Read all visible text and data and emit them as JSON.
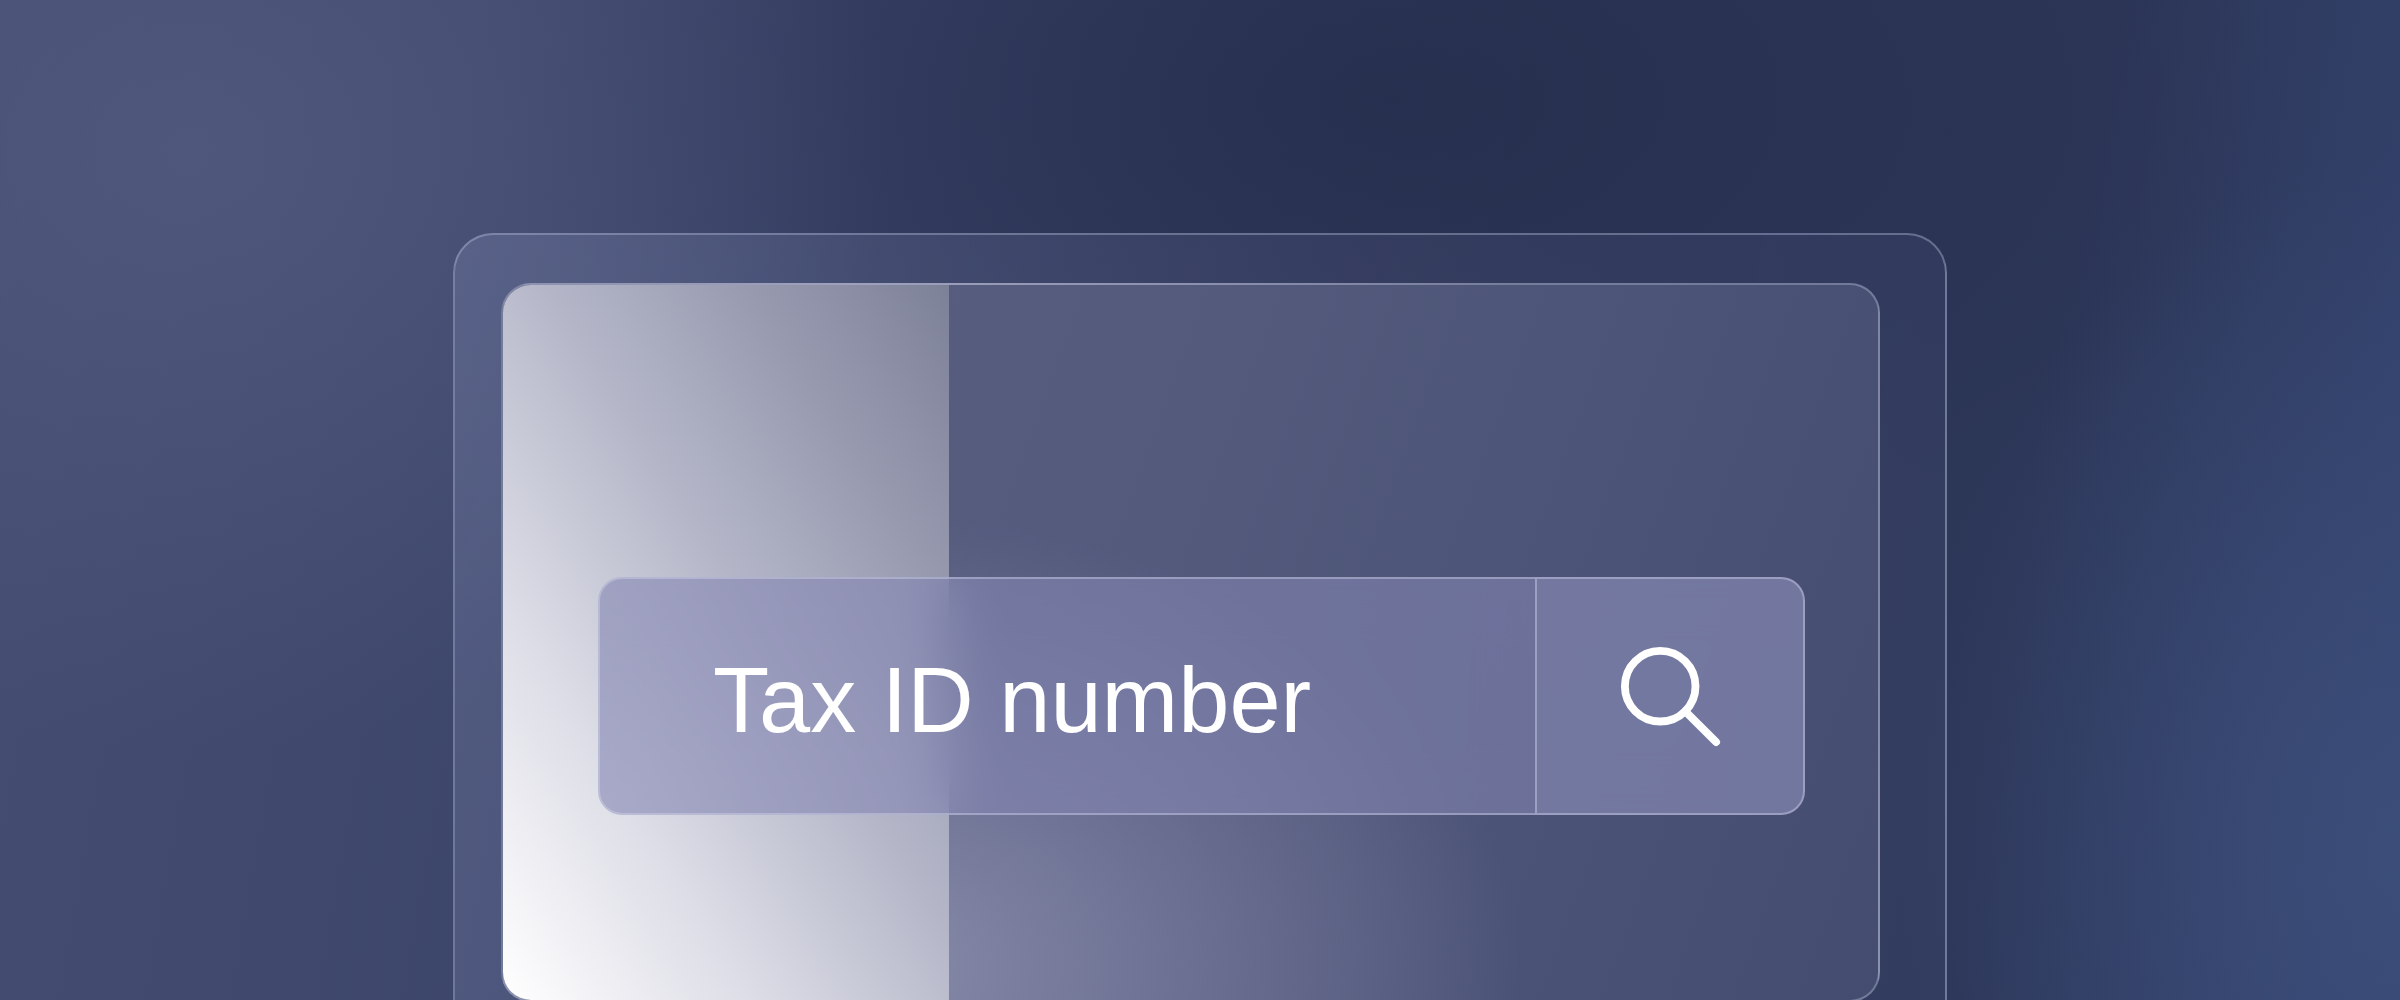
{
  "search": {
    "placeholder": "Tax ID number"
  }
}
